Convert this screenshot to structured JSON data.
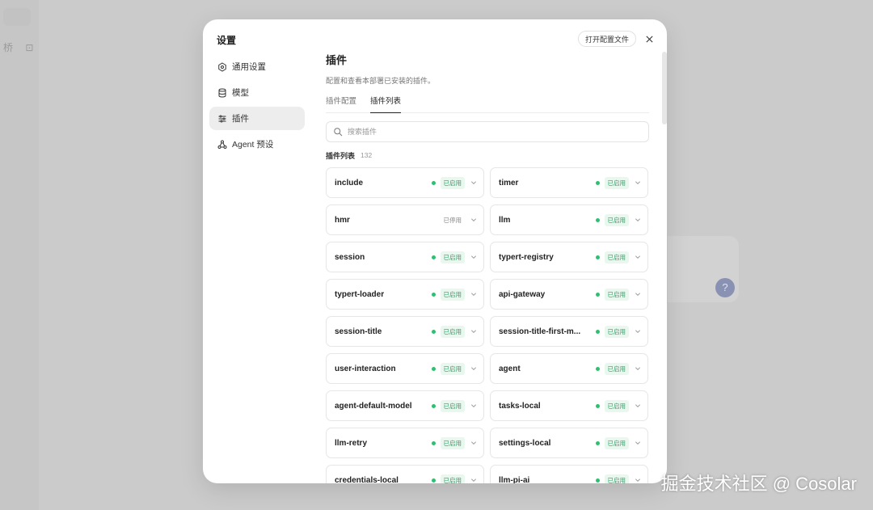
{
  "background": {
    "left_icons": "桥 ⊡",
    "help_icon": "?"
  },
  "modal": {
    "title": "设置",
    "open_config_label": "打开配置文件",
    "nav": [
      {
        "label": "通用设置",
        "icon": "gear-icon",
        "active": false
      },
      {
        "label": "模型",
        "icon": "database-icon",
        "active": false
      },
      {
        "label": "插件",
        "icon": "sliders-icon",
        "active": true
      },
      {
        "label": "Agent 预设",
        "icon": "agent-icon",
        "active": false
      }
    ]
  },
  "content": {
    "title": "插件",
    "description": "配置和查看本部署已安装的插件。",
    "tabs": [
      {
        "label": "插件配置",
        "active": false
      },
      {
        "label": "插件列表",
        "active": true
      }
    ],
    "search_placeholder": "搜索插件",
    "list_label": "插件列表",
    "list_count": "132"
  },
  "plugins": [
    {
      "name": "include",
      "status": "已启用",
      "enabled": true
    },
    {
      "name": "timer",
      "status": "已启用",
      "enabled": true
    },
    {
      "name": "hmr",
      "status": "已停用",
      "enabled": false
    },
    {
      "name": "llm",
      "status": "已启用",
      "enabled": true
    },
    {
      "name": "session",
      "status": "已启用",
      "enabled": true
    },
    {
      "name": "typert-registry",
      "status": "已启用",
      "enabled": true
    },
    {
      "name": "typert-loader",
      "status": "已启用",
      "enabled": true
    },
    {
      "name": "api-gateway",
      "status": "已启用",
      "enabled": true
    },
    {
      "name": "session-title",
      "status": "已启用",
      "enabled": true
    },
    {
      "name": "session-title-first-m...",
      "status": "已启用",
      "enabled": true
    },
    {
      "name": "user-interaction",
      "status": "已启用",
      "enabled": true
    },
    {
      "name": "agent",
      "status": "已启用",
      "enabled": true
    },
    {
      "name": "agent-default-model",
      "status": "已启用",
      "enabled": true
    },
    {
      "name": "tasks-local",
      "status": "已启用",
      "enabled": true
    },
    {
      "name": "llm-retry",
      "status": "已启用",
      "enabled": true
    },
    {
      "name": "settings-local",
      "status": "已启用",
      "enabled": true
    },
    {
      "name": "credentials-local",
      "status": "已启用",
      "enabled": true
    },
    {
      "name": "llm-pi-ai",
      "status": "已启用",
      "enabled": true
    }
  ],
  "watermark": "掘金技术社区 @ Cosolar",
  "colors": {
    "enabled_dot": "#2fbf71",
    "enabled_text": "#2fa466",
    "enabled_bg": "#e9f8ef"
  }
}
